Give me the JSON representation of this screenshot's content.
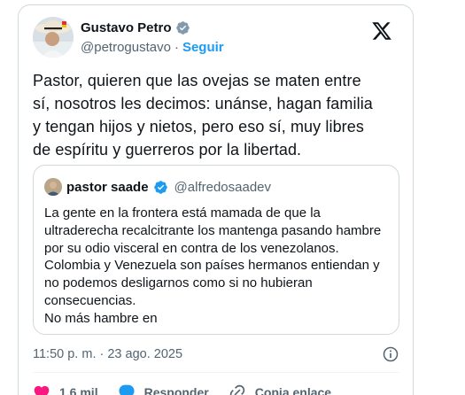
{
  "author": {
    "display_name": "Gustavo Petro",
    "handle": "@petrogustavo",
    "separator": "·",
    "follow_label": "Seguir",
    "verified": true
  },
  "tweet": {
    "text": "Pastor, quieren que las ovejas se maten entre\nsí, nosotros les decimos: unánse, hagan familia\ny tengan hijos y nietos, pero eso sí, muy libres\nde espíritu y guerreros por la libertad."
  },
  "quoted": {
    "display_name": "pastor saade",
    "handle": "@alfredosaadev",
    "verified": true,
    "text": "La gente en la frontera está mamada de que la\nultraderecha recalcitrante los mantenga pasando hambre\npor su odio visceral en contra de los venezolanos.\nColombia y Venezuela son países hermanos entiendan y\nno podemos desligarnos como si no hubieran\nconsecuencias.\nNo más hambre en"
  },
  "meta": {
    "timestamp": "11:50 p. m. · 23 ago. 2025"
  },
  "actions": {
    "like_count": "1,6 mil",
    "reply_label": "Responder",
    "copy_link_label": "Copia enlace"
  },
  "colors": {
    "accent": "#1d9bf0",
    "like": "#f91880",
    "secondary_text": "#536471",
    "border": "#cfd9de"
  },
  "icons": [
    "verified-badge-icon",
    "x-logo-icon",
    "info-icon",
    "heart-icon",
    "reply-bubble-icon",
    "link-icon"
  ]
}
